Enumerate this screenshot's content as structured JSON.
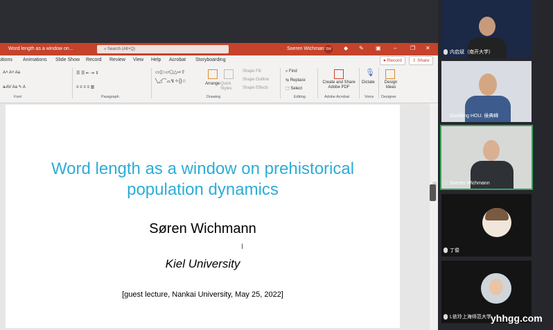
{
  "powerpoint": {
    "doc_title": "Word length as a window on...",
    "search_placeholder": "Search (Alt+Q)",
    "user_name": "Soeren Wichmann",
    "user_initials": "SW",
    "tabs": [
      "sitions",
      "Animations",
      "Slide Show",
      "Record",
      "Review",
      "View",
      "Help",
      "Acrobat",
      "Storyboarding"
    ],
    "record_label": "Record",
    "share_label": "Share",
    "groups": {
      "font": "Font",
      "paragraph": "Paragraph",
      "drawing": "Drawing",
      "editing": "Editing",
      "adobe": "Adobe Acrobat",
      "voice": "Voice",
      "designer": "Designer"
    },
    "buttons": {
      "arrange": "Arrange",
      "quick_styles": "Quick Styles",
      "shape_fill": "Shape Fill",
      "shape_outline": "Shape Outline",
      "shape_effects": "Shape Effects",
      "find": "Find",
      "replace": "Replace",
      "select": "Select",
      "create_pdf": "Create and Share Adobe PDF",
      "dictate": "Dictate",
      "design_ideas": "Design Ideas"
    }
  },
  "slide": {
    "title_line1": "Word length as a window on prehistorical",
    "title_line2": "population dynamics",
    "author": "Søren Wichmann",
    "institution": "Kiel University",
    "lecture": "[guest lecture, Nankai University, May 25, 2022]"
  },
  "participants": [
    {
      "name": "内启斌（南开大学）"
    },
    {
      "name": "Dianfeng HOU. 侯典峰"
    },
    {
      "name": "Soeren Wichmann"
    },
    {
      "name": "丁俊"
    },
    {
      "name": "L依玲上海师范大学"
    }
  ],
  "watermark": "yhhgg.com",
  "colors": {
    "accent": "#c5432a",
    "slide_title": "#2eacd7"
  }
}
